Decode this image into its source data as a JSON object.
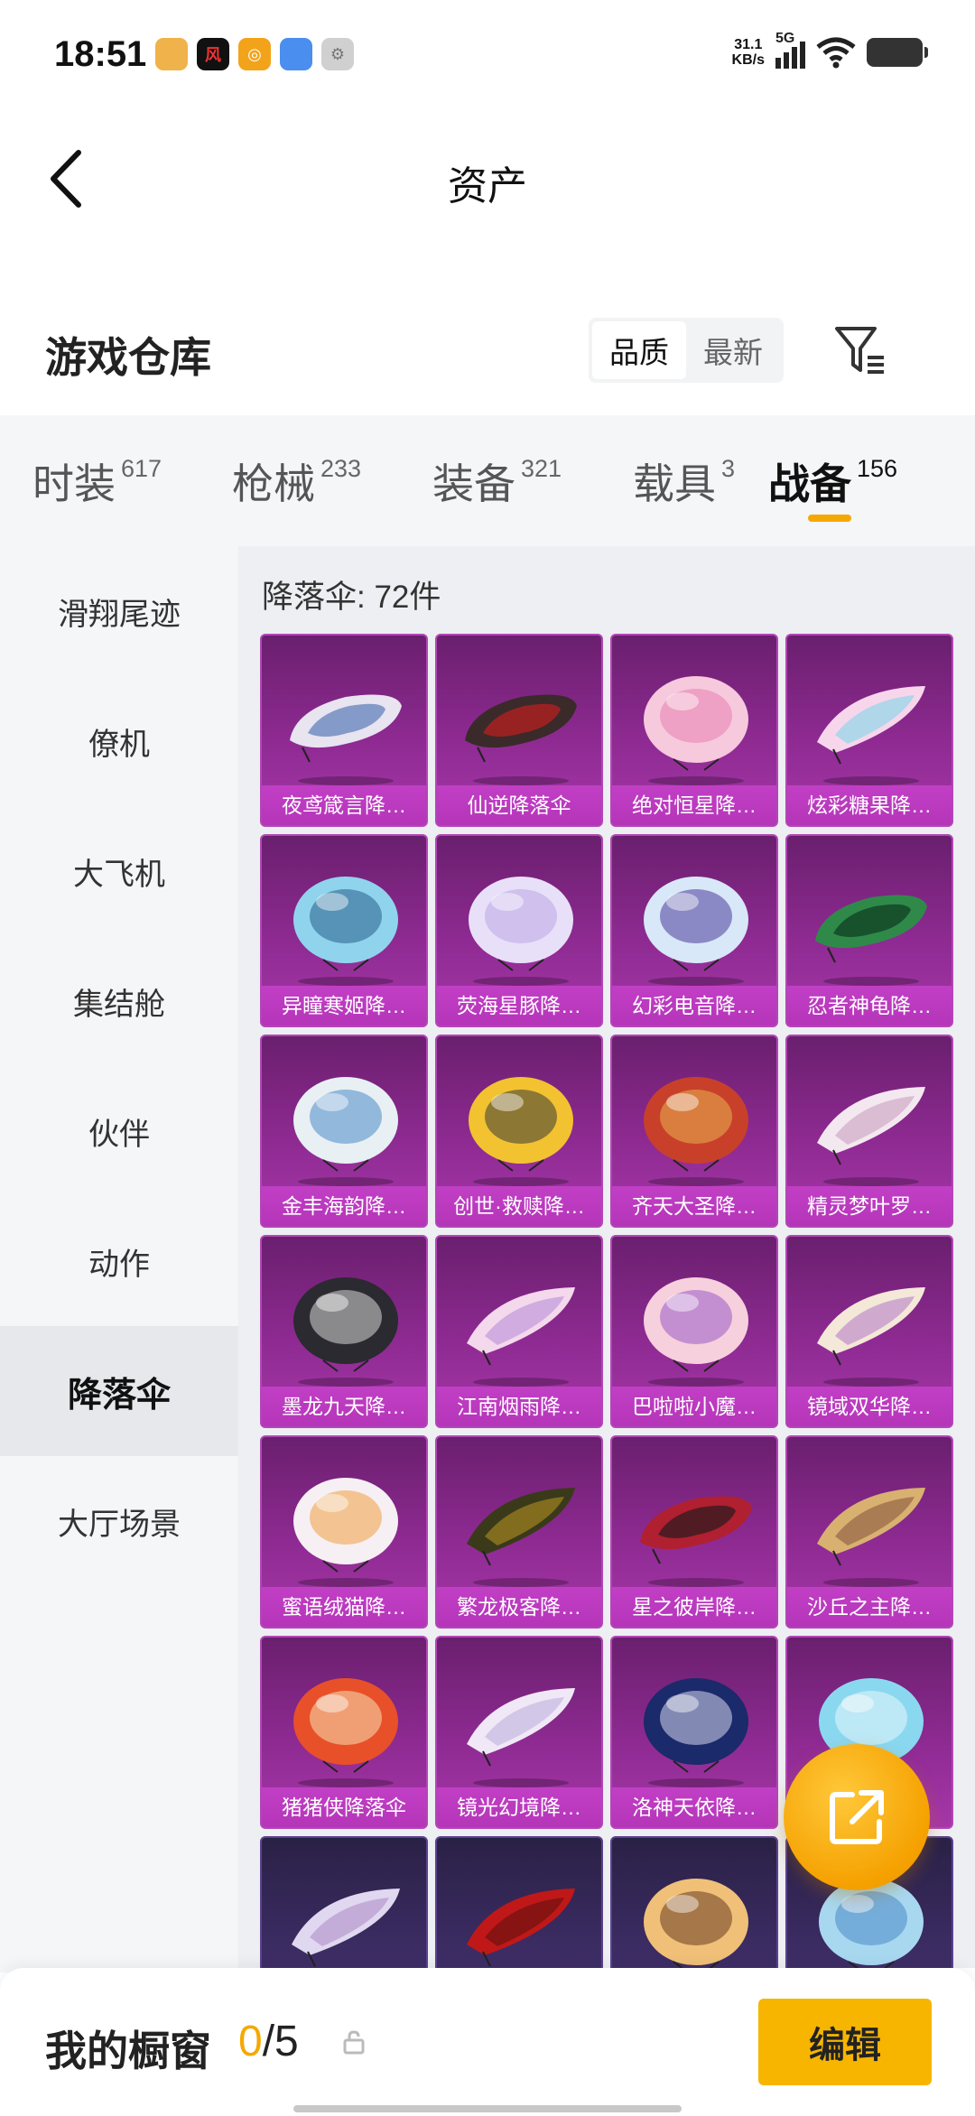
{
  "status": {
    "time": "18:51",
    "net_speed_value": "31.1",
    "net_speed_unit": "KB/s",
    "signal_label": "5G"
  },
  "nav": {
    "title": "资产"
  },
  "warehouse": {
    "title": "游戏仓库",
    "sort_options": [
      "品质",
      "最新"
    ]
  },
  "tabs": [
    {
      "label": "时装",
      "count": "617"
    },
    {
      "label": "枪械",
      "count": "233"
    },
    {
      "label": "装备",
      "count": "321"
    },
    {
      "label": "载具",
      "count": "3"
    },
    {
      "label": "战备",
      "count": "156"
    }
  ],
  "sidebar": {
    "items": [
      "滑翔尾迹",
      "僚机",
      "大飞机",
      "集结舱",
      "伙伴",
      "动作",
      "降落伞",
      "大厅场景"
    ],
    "active_index": 6
  },
  "content": {
    "heading": "降落伞: 72件",
    "items": [
      "夜鸢箴言降…",
      "仙逆降落伞",
      "绝对恒星降…",
      "炫彩糖果降…",
      "异瞳寒姬降…",
      "荧海星豚降…",
      "幻彩电音降…",
      "忍者神龟降…",
      "金丰海韵降…",
      "创世·救赎降…",
      "齐天大圣降…",
      "精灵梦叶罗…",
      "墨龙九天降…",
      "江南烟雨降…",
      "巴啦啦小魔…",
      "镜域双华降…",
      "蜜语绒猫降…",
      "繁龙极客降…",
      "星之彼岸降…",
      "沙丘之主降…",
      "猪猪侠降落伞",
      "镜光幻境降…",
      "洛神天依降…",
      "",
      "",
      "",
      "",
      ""
    ]
  },
  "bottom": {
    "window_label": "我的橱窗",
    "used": "0",
    "separator": "/",
    "total": "5",
    "edit_label": "编辑"
  },
  "colors": {
    "accent": "#f5a800",
    "card_purple": "#8e2a92",
    "card_label": "#b535b9"
  }
}
